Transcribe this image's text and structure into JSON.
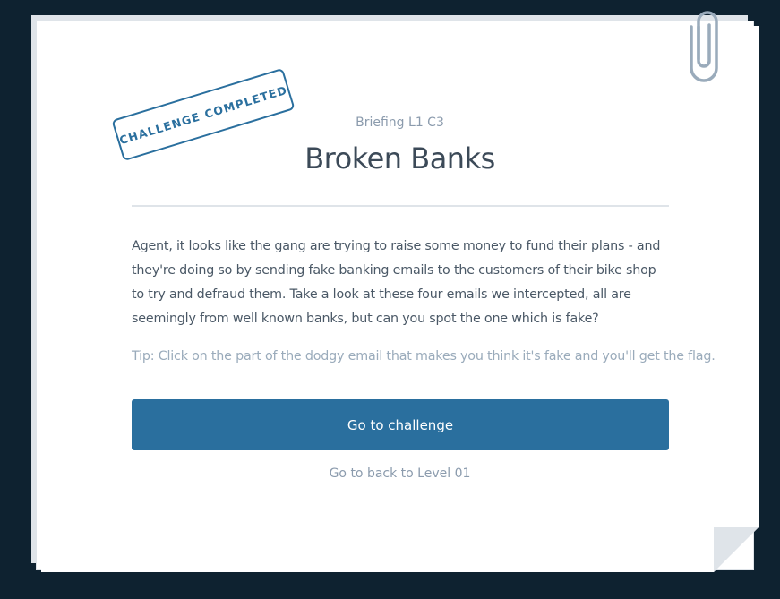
{
  "stamp": {
    "label": "CHALLENGE COMPLETED"
  },
  "briefing": {
    "subtitle": "Briefing L1 C3",
    "title": "Broken Banks",
    "description": "Agent, it looks like the gang are trying to raise some money to fund their plans - and they're doing so by sending fake banking emails to the customers of their bike shop to try and defraud them. Take a look at these four emails we intercepted, all are seemingly from well known banks, but can you spot the one which is fake?",
    "tip": "Tip: Click on the part of the dodgy email that makes you think it's fake and you'll get the flag."
  },
  "actions": {
    "primary_label": "Go to challenge",
    "back_label": "Go to back to Level 01"
  },
  "icons": {
    "paperclip": "paperclip-icon"
  },
  "colors": {
    "background": "#0e2230",
    "accent": "#2a6f9e",
    "paper": "#ffffff",
    "paper_shadow": "#dfe4e9",
    "title_text": "#3c4a58",
    "muted_text": "#8b9bad"
  }
}
